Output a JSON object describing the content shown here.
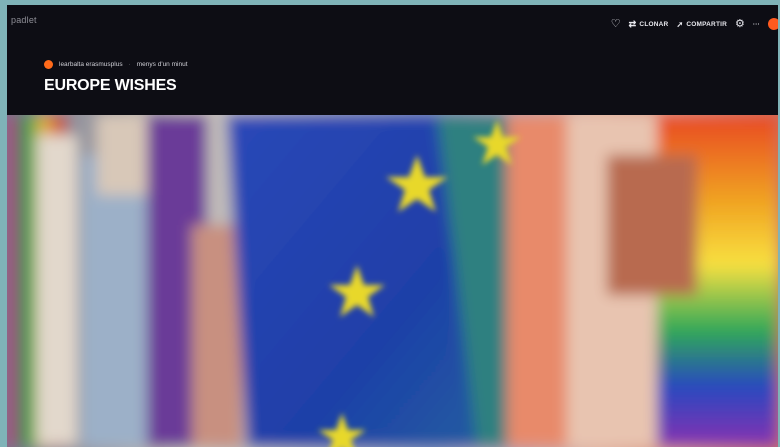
{
  "app": {
    "brand": "padlet"
  },
  "header": {
    "actions": {
      "clone_label": "CLONAR",
      "share_label": "COMPARTIR",
      "more_label": "···"
    },
    "author": "learbalta erasmusplus",
    "timestamp": "menys d'un minut",
    "title": "EUROPE WISHES"
  },
  "colors": {
    "accent": "#ff5a1f",
    "header_bg": "#0d0d14",
    "eu_blue": "#1f3fa8",
    "eu_star": "#e8d82a"
  },
  "icons": {
    "favorite": "heart-icon",
    "clone": "clone-icon",
    "share": "share-icon",
    "settings": "gear-icon",
    "more": "more-icon"
  }
}
